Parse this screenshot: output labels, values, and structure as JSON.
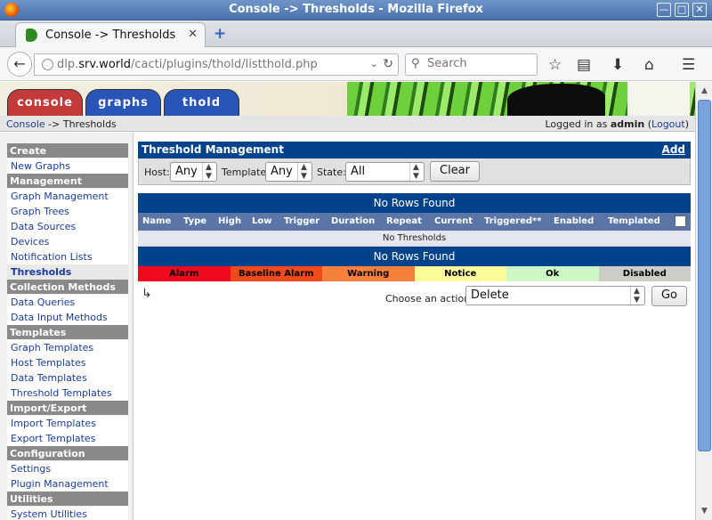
{
  "window": {
    "title": "Console -> Thresholds - Mozilla Firefox"
  },
  "browser": {
    "tab_title": "Console -> Thresholds",
    "url_prefix": "dlp.",
    "url_host": "srv.world",
    "url_path": "/cacti/plugins/thold/listthold.php",
    "search_placeholder": "Search"
  },
  "app": {
    "tabs": [
      {
        "label": "console",
        "color": "#c23a3a"
      },
      {
        "label": "graphs",
        "color": "#2a55b8"
      },
      {
        "label": "thold",
        "color": "#2a55b8"
      }
    ],
    "breadcrumb": {
      "link": "Console",
      "current": " -> Thresholds"
    },
    "login": {
      "prefix": "Logged in as ",
      "user": "admin",
      "logout": "Logout"
    }
  },
  "sidebar": {
    "sections": [
      {
        "header": "Create",
        "items": [
          "New Graphs"
        ]
      },
      {
        "header": "Management",
        "items": [
          "Graph Management",
          "Graph Trees",
          "Data Sources",
          "Devices",
          "Notification Lists",
          "Thresholds"
        ]
      },
      {
        "header": "Collection Methods",
        "items": [
          "Data Queries",
          "Data Input Methods"
        ]
      },
      {
        "header": "Templates",
        "items": [
          "Graph Templates",
          "Host Templates",
          "Data Templates",
          "Threshold Templates"
        ]
      },
      {
        "header": "Import/Export",
        "items": [
          "Import Templates",
          "Export Templates"
        ]
      },
      {
        "header": "Configuration",
        "items": [
          "Settings",
          "Plugin Management"
        ]
      },
      {
        "header": "Utilities",
        "items": [
          "System Utilities"
        ]
      }
    ],
    "active": "Thresholds"
  },
  "panel": {
    "title": "Threshold Management",
    "add_label": "Add",
    "filters": {
      "host_label": "Host:",
      "host_value": "Any",
      "template_label": "Template:",
      "template_value": "Any",
      "state_label": "State:",
      "state_value": "All",
      "clear_label": "Clear"
    }
  },
  "results": {
    "no_rows_top": "No Rows Found",
    "columns": [
      "Name",
      "Type",
      "High",
      "Low",
      "Trigger",
      "Duration",
      "Repeat",
      "Current",
      "Triggered**",
      "Enabled",
      "Templated"
    ],
    "empty_text": "No Thresholds",
    "no_rows_bottom": "No Rows Found"
  },
  "legend": [
    {
      "label": "Alarm",
      "color": "#f00a1e"
    },
    {
      "label": "Baseline Alarm",
      "color": "#f04a1a"
    },
    {
      "label": "Warning",
      "color": "#f7813c"
    },
    {
      "label": "Notice",
      "color": "#fbfb9a"
    },
    {
      "label": "Ok",
      "color": "#cdf7c4"
    },
    {
      "label": "Disabled",
      "color": "#ceccc6"
    }
  ],
  "action": {
    "label": "Choose an action:",
    "value": "Delete",
    "go_label": "Go"
  }
}
